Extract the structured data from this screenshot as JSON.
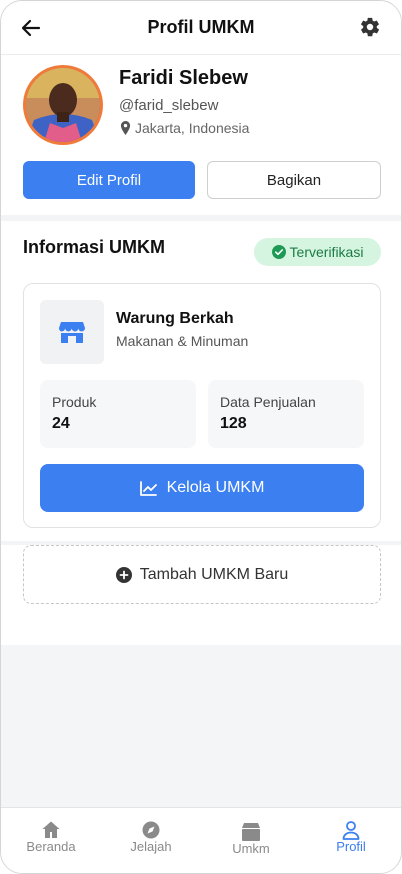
{
  "header": {
    "title": "Profil UMKM"
  },
  "profile": {
    "name": "Faridi Slebew",
    "username": "@farid_slebew",
    "location": "Jakarta, Indonesia",
    "edit_label": "Edit Profil",
    "share_label": "Bagikan"
  },
  "umkm": {
    "section_title": "Informasi UMKM",
    "verified_label": "Terverifikasi",
    "store_name": "Warung Berkah",
    "store_category": "Makanan & Minuman",
    "stats": [
      {
        "label": "Produk",
        "value": "24"
      },
      {
        "label": "Data Penjualan",
        "value": "128"
      }
    ],
    "manage_label": "Kelola UMKM",
    "add_label": "Tambah UMKM Baru"
  },
  "nav": {
    "items": [
      {
        "label": "Beranda",
        "icon": "home-icon"
      },
      {
        "label": "Jelajah",
        "icon": "compass-icon"
      },
      {
        "label": "Umkm",
        "icon": "store-icon"
      },
      {
        "label": "Profil",
        "icon": "user-icon",
        "active": true
      }
    ]
  },
  "colors": {
    "accent": "#3b7ff0",
    "verified_bg": "#d6f5e1",
    "verified_text": "#1b7a44",
    "avatar_ring": "#f07a3a"
  }
}
